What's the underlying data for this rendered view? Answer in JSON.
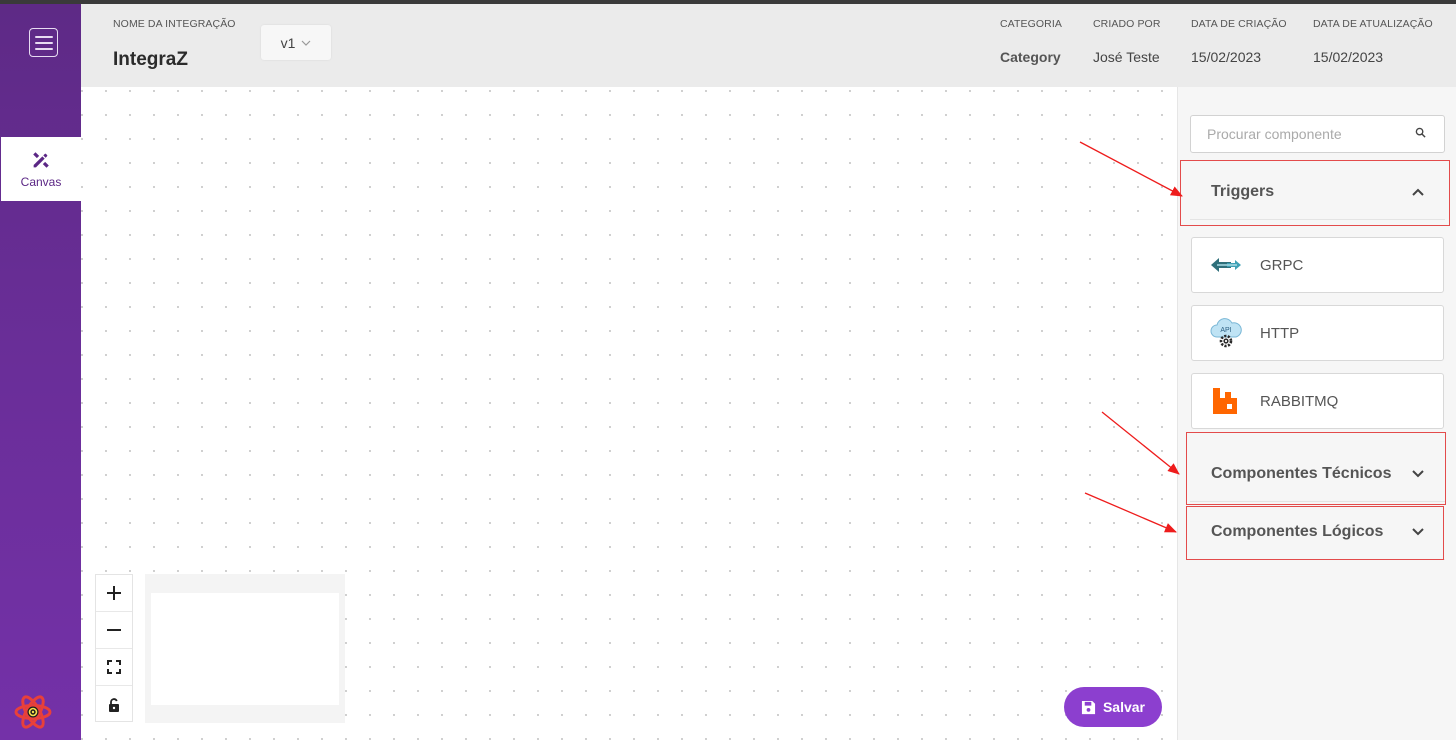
{
  "sidebar": {
    "menu_icon": "hamburger-icon",
    "canvas_label": "Canvas",
    "canvas_icon": "edit-tools-icon",
    "logo_icon": "react-logo-icon",
    "accent": "#6a2e99"
  },
  "header": {
    "name_label": "NOME DA INTEGRAÇÃO",
    "name_value": "IntegraZ",
    "version": "v1",
    "category_label": "CATEGORIA",
    "category_value": "Category",
    "created_by_label": "CRIADO POR",
    "created_by_value": "José Teste",
    "created_date_label": "DATA DE CRIAÇÃO",
    "created_date_value": "15/02/2023",
    "updated_date_label": "DATA DE ATUALIZAÇÃO",
    "updated_date_value": "15/02/2023"
  },
  "canvas": {
    "save_label": "Salvar",
    "save_color": "#8c3fcf",
    "controls": [
      "plus-icon",
      "minus-icon",
      "fit-view-icon",
      "lock-icon"
    ]
  },
  "panel": {
    "search_placeholder": "Procurar componente",
    "sections": {
      "triggers": {
        "title": "Triggers",
        "expanded": true,
        "items": [
          {
            "name": "GRPC",
            "icon": "grpc-icon"
          },
          {
            "name": "HTTP",
            "icon": "api-cloud-icon"
          },
          {
            "name": "RABBITMQ",
            "icon": "rabbitmq-icon"
          }
        ]
      },
      "tecnicos": {
        "title": "Componentes Técnicos",
        "expanded": false
      },
      "logicos": {
        "title": "Componentes Lógicos",
        "expanded": false
      }
    }
  },
  "annotations": {
    "highlight_color": "#e34b4b"
  }
}
